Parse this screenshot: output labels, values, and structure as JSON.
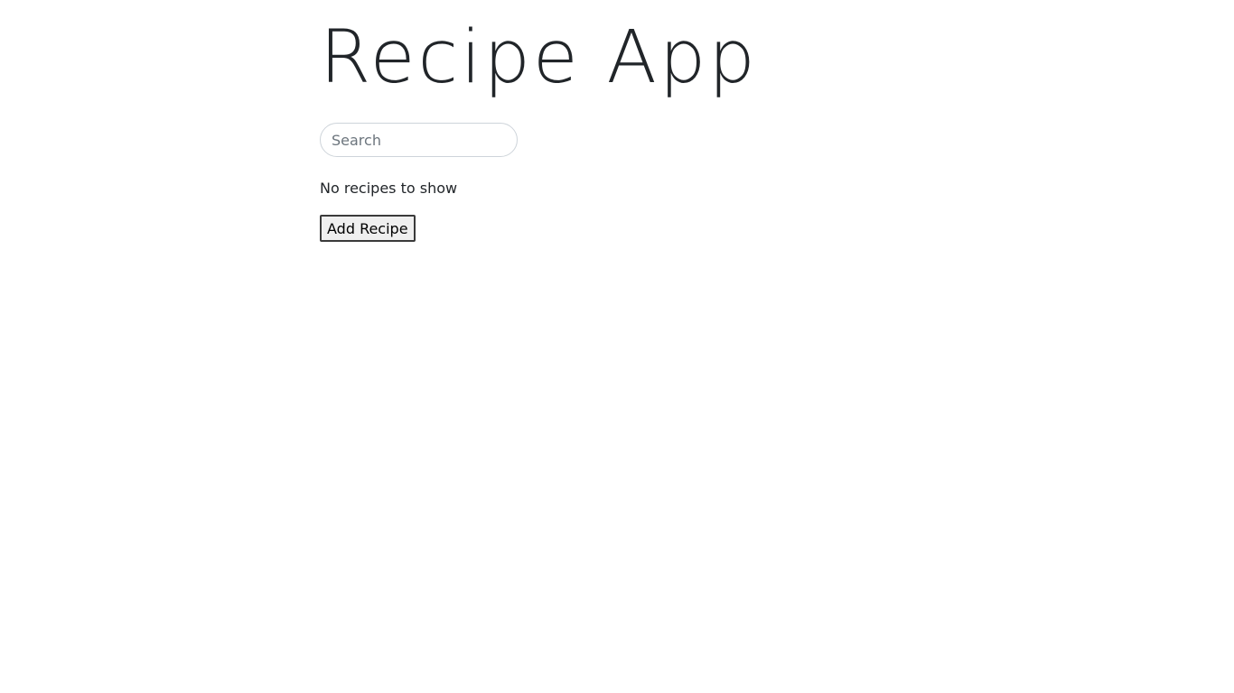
{
  "header": {
    "title": "Recipe App"
  },
  "search": {
    "placeholder": "Search",
    "value": ""
  },
  "recipes": {
    "empty_message": "No recipes to show",
    "items": []
  },
  "actions": {
    "add_label": "Add Recipe"
  }
}
